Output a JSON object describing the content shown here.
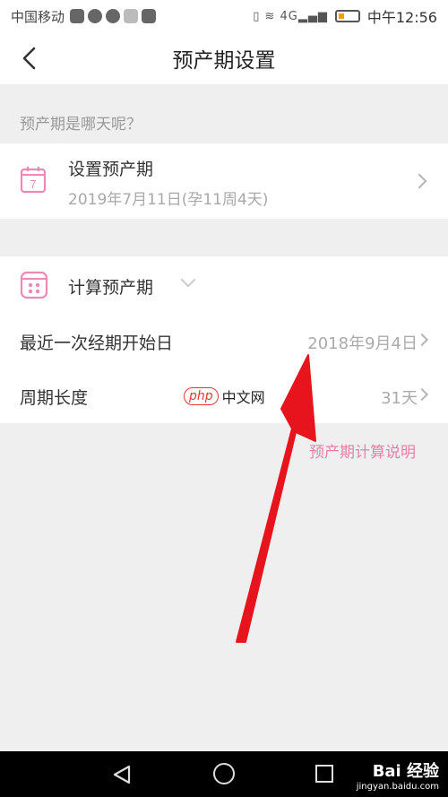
{
  "status_bar": {
    "carrier": "中国移动",
    "network": "4G",
    "time": "中午12:56"
  },
  "header": {
    "title": "预产期设置",
    "back_icon": "chevron-left-icon"
  },
  "section_label": "预产期是哪天呢？",
  "set_due_date": {
    "icon": "calendar-icon",
    "icon_number": "7",
    "label": "设置预产期",
    "value": "2019年7月11日(孕11周4天)"
  },
  "calculate": {
    "icon": "calculator-icon",
    "label": "计算预产期",
    "rows": [
      {
        "label": "最近一次经期开始日",
        "value": "2018年9月4日"
      },
      {
        "label": "周期长度",
        "value": "31天"
      }
    ]
  },
  "explain_link": "预产期计算说明",
  "watermark": {
    "badge": "php",
    "text": "中文网"
  },
  "nav_watermark": {
    "brand": "Bai 经验",
    "url": "jingyan.baidu.com"
  },
  "colors": {
    "accent_pink": "#e77fa6",
    "icon_pink": "#e98ab9",
    "annotation_red": "#e8141d"
  }
}
